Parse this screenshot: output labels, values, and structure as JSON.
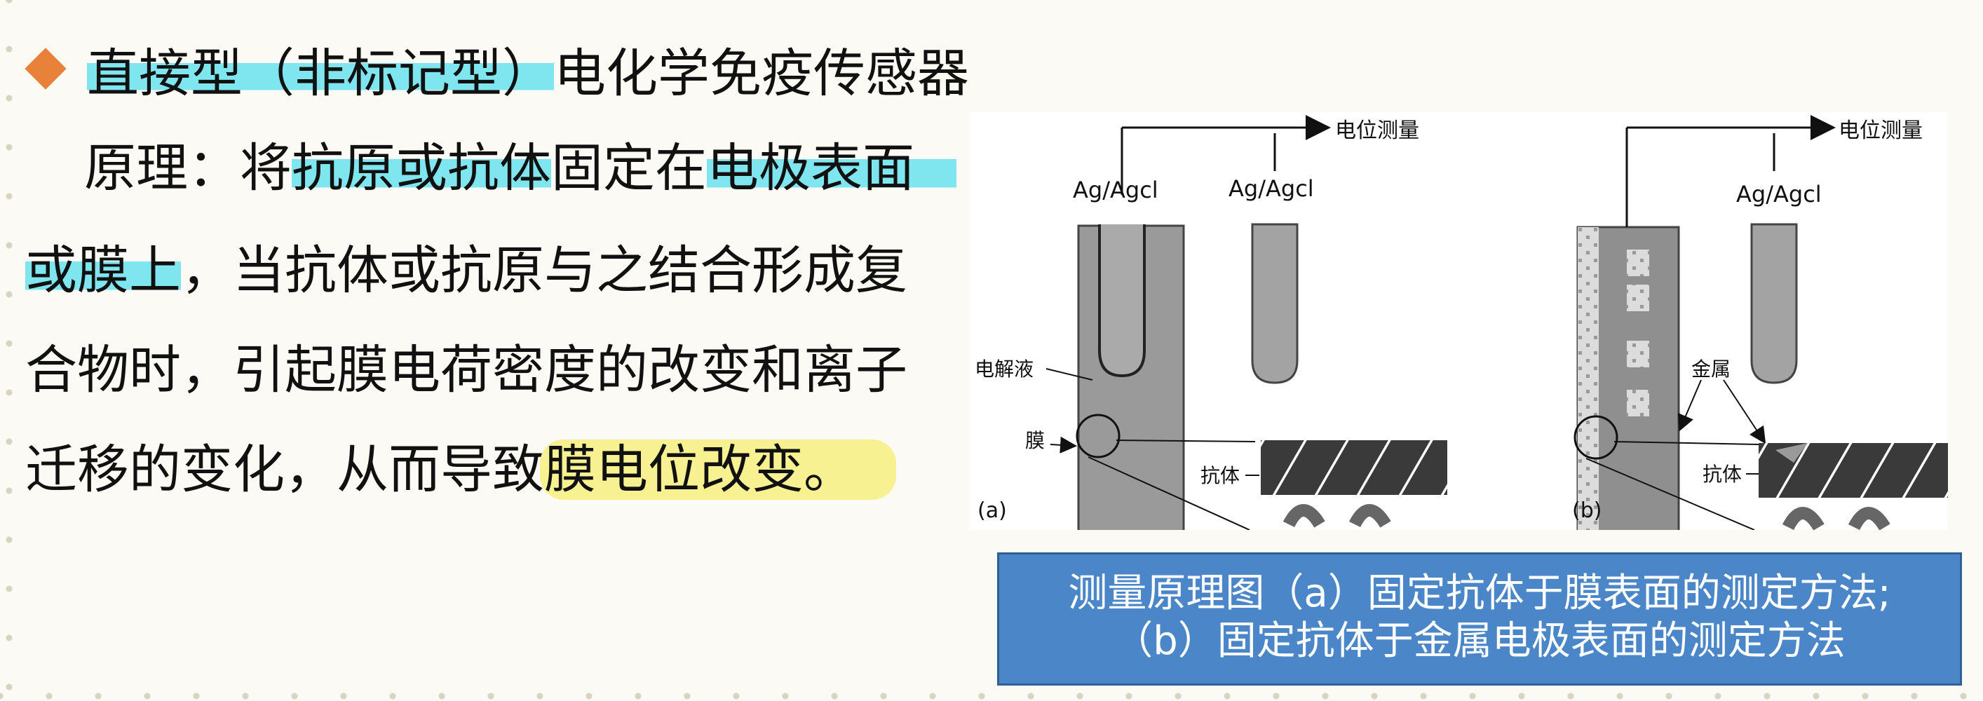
{
  "heading": {
    "part1": "直接型（非标记型）",
    "part2": "电化学免疫传感器"
  },
  "body": {
    "line1_a": "原理：将",
    "line1_b": "抗原或抗体",
    "line1_c": "固定在",
    "line1_d": "电极表面",
    "line2_a": "或膜上",
    "line2_b": "，当抗体或抗原与之结合形成复",
    "line3": "合物时，引起膜电荷密度的改变和离子",
    "line4_a": "迁移的变化，从而导致",
    "line4_b": "膜电位改变。"
  },
  "figure": {
    "a": {
      "panel_label": "(a)",
      "ref_left": "Ag/Agcl",
      "ref_right": "Ag/Agcl",
      "measure": "电位测量",
      "electrolyte": "电解液",
      "membrane": "膜",
      "antibody": "抗体"
    },
    "b": {
      "panel_label": "(b)",
      "ref": "Ag/Agcl",
      "measure": "电位测量",
      "metal": "金属",
      "antibody": "抗体"
    }
  },
  "caption": {
    "line1": "测量原理图（a）固定抗体于膜表面的测定方法;",
    "line2": "（b）固定抗体于金属电极表面的测定方法"
  },
  "colors": {
    "bullet": "#e8823a",
    "highlight_cyan": "#7fe5ef",
    "highlight_yellow": "#f8f191",
    "caption_bg": "#4a86c8"
  }
}
